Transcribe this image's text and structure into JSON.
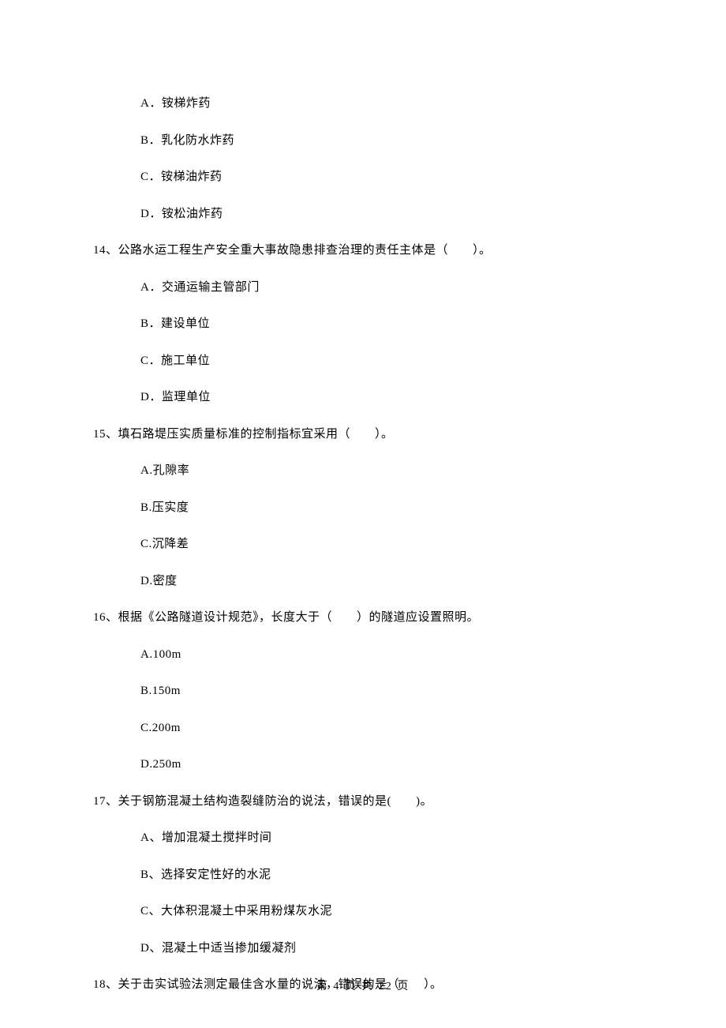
{
  "q13_options": {
    "A": "A．铵梯炸药",
    "B": "B．乳化防水炸药",
    "C": "C．铵梯油炸药",
    "D": "D．铵松油炸药"
  },
  "q14": {
    "stem": "14、公路水运工程生产安全重大事故隐患排查治理的责任主体是（　　）。",
    "A": "A．交通运输主管部门",
    "B": "B．建设单位",
    "C": "C．施工单位",
    "D": "D．监理单位"
  },
  "q15": {
    "stem": "15、填石路堤压实质量标准的控制指标宜采用（　　）。",
    "A": "A.孔隙率",
    "B": "B.压实度",
    "C": "C.沉降差",
    "D": "D.密度"
  },
  "q16": {
    "stem": "16、根据《公路隧道设计规范》，长度大于（　　）的隧道应设置照明。",
    "A": "A.100m",
    "B": "B.150m",
    "C": "C.200m",
    "D": "D.250m"
  },
  "q17": {
    "stem": "17、关于钢筋混凝土结构造裂缝防治的说法，错误的是(　　)。",
    "A": "A、增加混凝土搅拌时间",
    "B": "B、选择安定性好的水泥",
    "C": "C、大体积混凝土中采用粉煤灰水泥",
    "D": "D、混凝土中适当掺加缓凝剂"
  },
  "q18": {
    "stem": "18、关于击实试验法测定最佳含水量的说法，错误的是（　　）。"
  },
  "footer": "第 4 页 共 22 页"
}
